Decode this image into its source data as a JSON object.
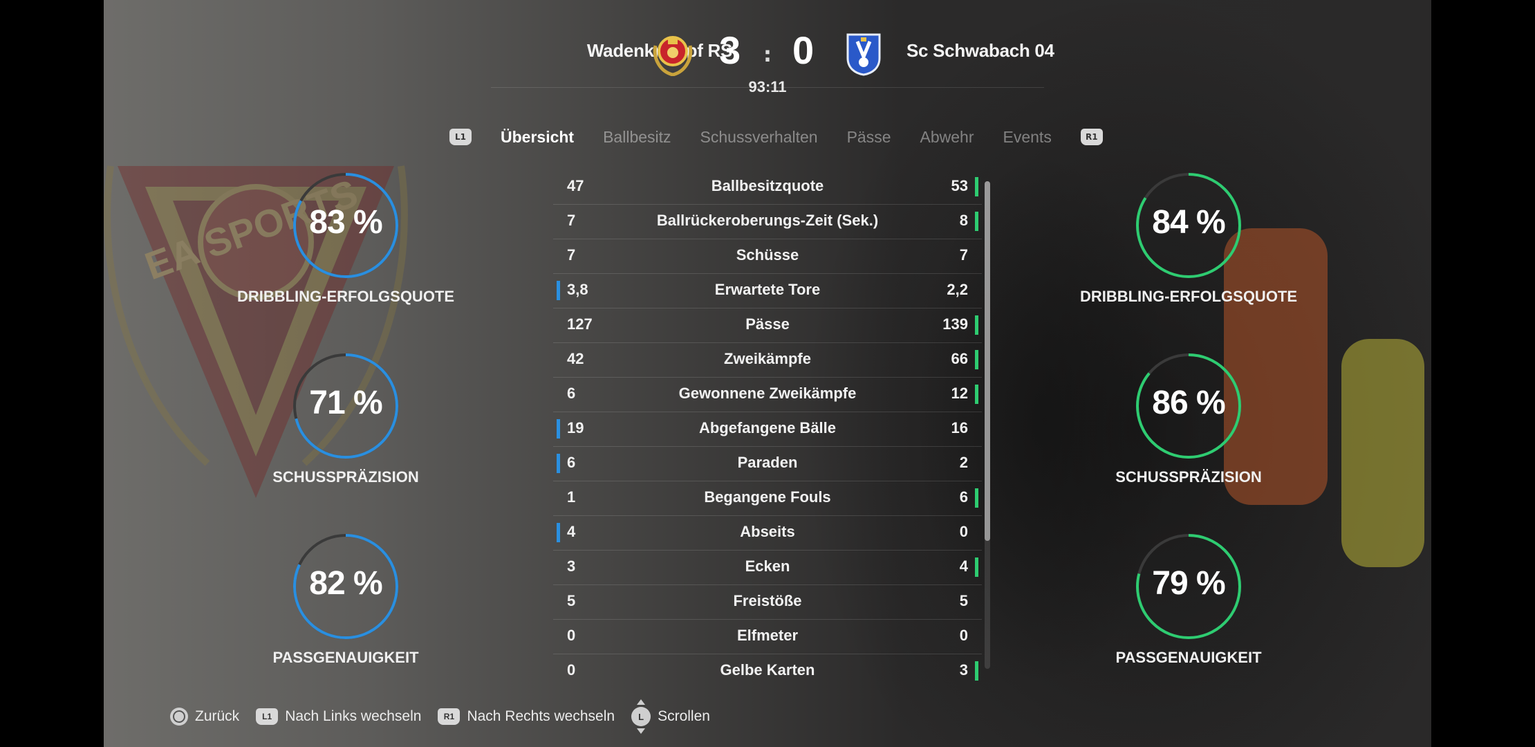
{
  "header": {
    "home_team": "Wadenkrampf RS",
    "away_team": "Sc Schwabach 04",
    "home_score": "3",
    "separator": ":",
    "away_score": "0",
    "clock": "93:11"
  },
  "tabs": {
    "left_shoulder": "L1",
    "right_shoulder": "R1",
    "items": [
      "Übersicht",
      "Ballbesitz",
      "Schussverhalten",
      "Pässe",
      "Abwehr",
      "Events"
    ],
    "active": "Übersicht"
  },
  "home_rings": [
    {
      "value": "83 %",
      "percent": 83,
      "label": "DRIBBLING-ERFOLGSQUOTE"
    },
    {
      "value": "71 %",
      "percent": 71,
      "label": "SCHUSSPRÄZISION"
    },
    {
      "value": "82 %",
      "percent": 82,
      "label": "PASSGENAUIGKEIT"
    }
  ],
  "away_rings": [
    {
      "value": "84 %",
      "percent": 84,
      "label": "DRIBBLING-ERFOLGSQUOTE"
    },
    {
      "value": "86 %",
      "percent": 86,
      "label": "SCHUSSPRÄZISION"
    },
    {
      "value": "79 %",
      "percent": 79,
      "label": "PASSGENAUIGKEIT"
    }
  ],
  "stats": [
    {
      "home": "47",
      "name": "Ballbesitzquote",
      "away": "53",
      "leader": "away"
    },
    {
      "home": "7",
      "name": "Ballrückeroberungs-Zeit (Sek.)",
      "away": "8",
      "leader": "away"
    },
    {
      "home": "7",
      "name": "Schüsse",
      "away": "7",
      "leader": "none"
    },
    {
      "home": "3,8",
      "name": "Erwartete Tore",
      "away": "2,2",
      "leader": "home"
    },
    {
      "home": "127",
      "name": "Pässe",
      "away": "139",
      "leader": "away"
    },
    {
      "home": "42",
      "name": "Zweikämpfe",
      "away": "66",
      "leader": "away"
    },
    {
      "home": "6",
      "name": "Gewonnene Zweikämpfe",
      "away": "12",
      "leader": "away"
    },
    {
      "home": "19",
      "name": "Abgefangene Bälle",
      "away": "16",
      "leader": "home"
    },
    {
      "home": "6",
      "name": "Paraden",
      "away": "2",
      "leader": "home"
    },
    {
      "home": "1",
      "name": "Begangene Fouls",
      "away": "6",
      "leader": "away"
    },
    {
      "home": "4",
      "name": "Abseits",
      "away": "0",
      "leader": "home"
    },
    {
      "home": "3",
      "name": "Ecken",
      "away": "4",
      "leader": "away"
    },
    {
      "home": "5",
      "name": "Freistöße",
      "away": "5",
      "leader": "none"
    },
    {
      "home": "0",
      "name": "Elfmeter",
      "away": "0",
      "leader": "none"
    },
    {
      "home": "0",
      "name": "Gelbe Karten",
      "away": "3",
      "leader": "away"
    }
  ],
  "footer": {
    "back": "Zurück",
    "left_btn": "L1",
    "left_label": "Nach Links wechseln",
    "right_btn": "R1",
    "right_label": "Nach Rechts wechseln",
    "scroll_btn": "L",
    "scroll_label": "Scrollen"
  },
  "colors": {
    "home_accent": "#2a8fe0",
    "away_accent": "#2ecc71",
    "ring_track": "#3a3a3a"
  },
  "icons": [
    "home-team-crest-icon",
    "away-team-crest-icon",
    "l1-button-icon",
    "r1-button-icon",
    "circle-button-icon",
    "left-stick-icon"
  ],
  "background": {
    "watermark_text": "EA SPORTS"
  }
}
